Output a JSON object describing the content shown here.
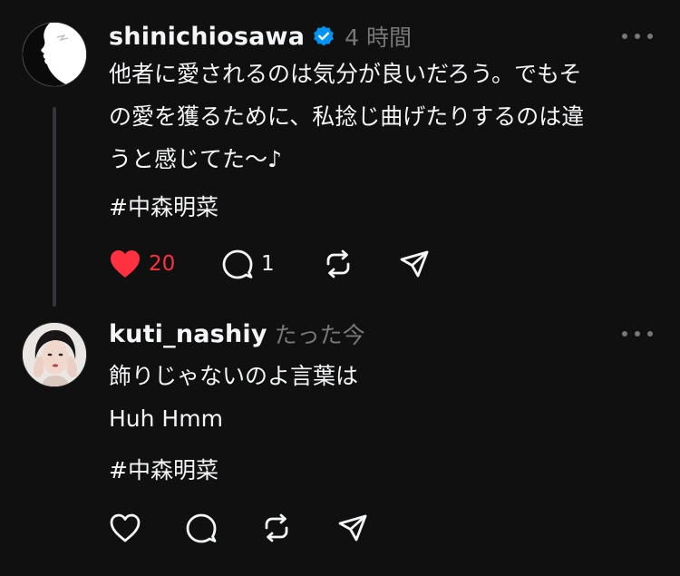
{
  "colors": {
    "background": "#101010",
    "text_primary": "#f3f5f7",
    "text_secondary": "#777777",
    "like_red": "#ff3040",
    "verified_blue": "#0095f6",
    "thread_line": "#333638"
  },
  "posts": [
    {
      "username": "shinichiosawa",
      "verified": true,
      "time": "4 時間",
      "lines": [
        "他者に愛されるのは気分が良いだろう。でもそ",
        "の愛を獲るために、私捻じ曲げたりするのは違",
        "うと感じてた〜♪"
      ],
      "hashtag": "#中森明菜",
      "liked": true,
      "likes": "20",
      "replies": "1",
      "icons": [
        "heart-filled-icon",
        "comment-icon",
        "repost-icon",
        "share-icon",
        "more-icon",
        "verified-badge-icon"
      ]
    },
    {
      "username": "kuti_nashiy",
      "verified": false,
      "time": "たった今",
      "lines": [
        "飾りじゃないのよ言葉は",
        "Huh Hmm"
      ],
      "hashtag": "#中森明菜",
      "liked": false,
      "icons": [
        "heart-outline-icon",
        "comment-icon",
        "repost-icon",
        "share-icon",
        "more-icon"
      ]
    }
  ]
}
